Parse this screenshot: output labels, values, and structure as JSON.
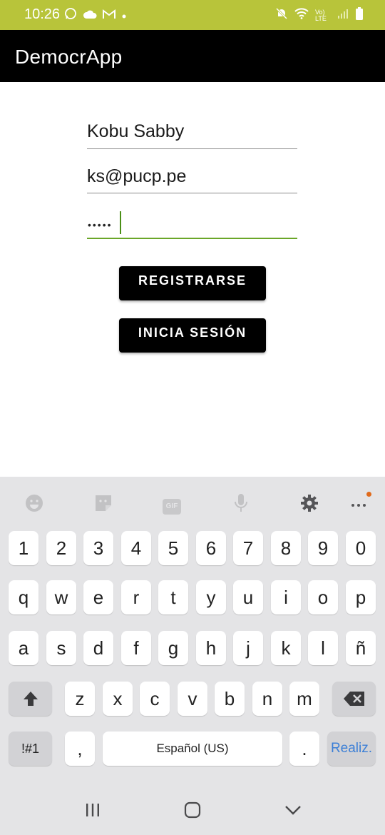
{
  "status": {
    "time": "10:26",
    "left_icons": [
      "whatsapp-icon",
      "cloud-icon",
      "gmail-icon",
      "dot-icon"
    ],
    "right_icons": [
      "mute-icon",
      "wifi-icon",
      "volte-icon",
      "signal-icon",
      "battery-icon"
    ],
    "volte_label": "Vo) LTE"
  },
  "app": {
    "title": "DemocrApp"
  },
  "form": {
    "name_value": "Kobu Sabby",
    "email_value": "ks@pucp.pe",
    "password_mask": "•••••",
    "register_label": "REGISTRARSE",
    "login_label": "INICIA SESIÓN"
  },
  "keyboard": {
    "toolbar": [
      "emoji-icon",
      "sticker-icon",
      "gif-icon",
      "mic-icon",
      "settings-icon",
      "more-icon"
    ],
    "gif_label": "GIF",
    "row_numbers": [
      "1",
      "2",
      "3",
      "4",
      "5",
      "6",
      "7",
      "8",
      "9",
      "0"
    ],
    "row1": [
      "q",
      "w",
      "e",
      "r",
      "t",
      "y",
      "u",
      "i",
      "o",
      "p"
    ],
    "row2": [
      "a",
      "s",
      "d",
      "f",
      "g",
      "h",
      "j",
      "k",
      "l",
      "ñ"
    ],
    "row3": [
      "z",
      "x",
      "c",
      "v",
      "b",
      "n",
      "m"
    ],
    "symbols_label": "!#1",
    "comma_label": ",",
    "space_label": "Español (US)",
    "period_label": ".",
    "action_label": "Realiz."
  },
  "colors": {
    "status_bar": "#b8c43a",
    "app_bar": "#000000",
    "accent_underline": "#6aa628",
    "action_text": "#3c7fd6"
  }
}
